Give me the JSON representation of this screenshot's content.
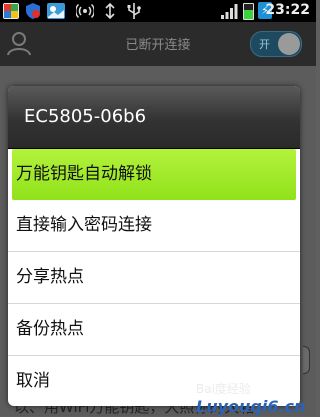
{
  "status_bar": {
    "time": "23:22",
    "icons": [
      "app-icon",
      "shield-icon",
      "image-icon",
      "wifi-hotspot-icon",
      "sync-icon",
      "usb-icon",
      "signal-icon",
      "battery-icon",
      "charging-icon"
    ],
    "battery_level": 0.62
  },
  "app_bar": {
    "title": "已断开连接",
    "switch_label": "开"
  },
  "dialog": {
    "title": "EC5805-06b6",
    "items": [
      {
        "label": "万能钥匙自动解锁",
        "selected": true
      },
      {
        "label": "直接输入密码连接",
        "selected": false
      },
      {
        "label": "分享热点",
        "selected": false
      },
      {
        "label": "备份热点",
        "selected": false
      },
      {
        "label": "取消",
        "selected": false
      }
    ]
  },
  "background": {
    "footer_text": "以、用WiFi万能钥匙，大照你的大箱"
  },
  "watermark": {
    "line1": "Bai度经验",
    "line2": "Luyouqi6.cn"
  },
  "colors": {
    "selected_item": "#9de52a",
    "dialog_title_bg": "#333333"
  }
}
